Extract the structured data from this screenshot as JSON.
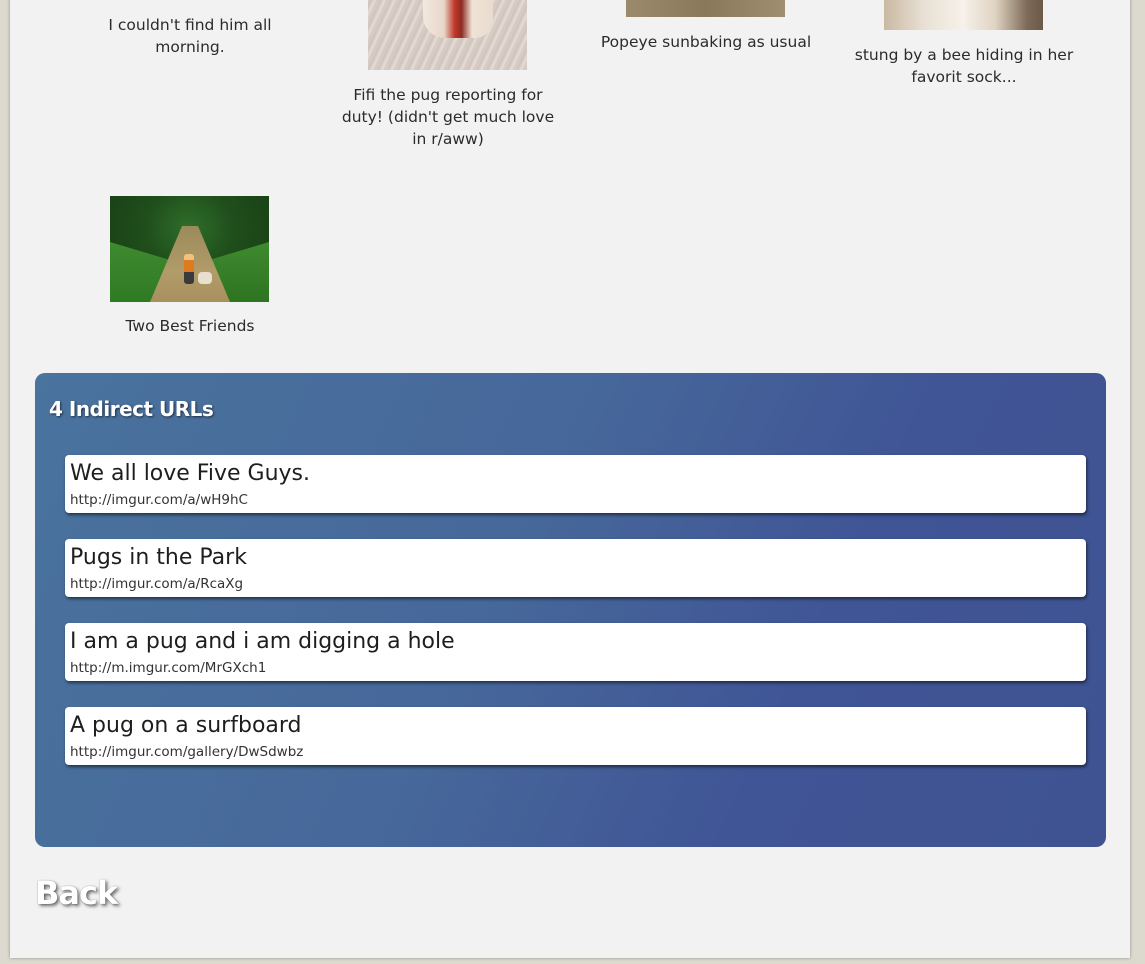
{
  "gallery": {
    "items": [
      {
        "caption": "I couldn't find him all morning."
      },
      {
        "caption": "Fifi the pug reporting for duty! (didn't get much love in r/aww)"
      },
      {
        "caption": "Popeye sunbaking as usual"
      },
      {
        "caption": "stung by a bee hiding in her favorit sock..."
      },
      {
        "caption": "Two Best Friends"
      }
    ]
  },
  "indirect": {
    "heading": "4 Indirect URLs",
    "links": [
      {
        "title": "We all love Five Guys.",
        "url": "http://imgur.com/a/wH9hC"
      },
      {
        "title": "Pugs in the Park",
        "url": "http://imgur.com/a/RcaXg"
      },
      {
        "title": "I am a pug and i am digging a hole",
        "url": "http://m.imgur.com/MrGXch1"
      },
      {
        "title": "A pug on a surfboard",
        "url": "http://imgur.com/gallery/DwSdwbz"
      }
    ]
  },
  "nav": {
    "back_label": "Back"
  },
  "colors": {
    "panel_start": "#4a739e",
    "panel_end": "#3f5392",
    "page_bg": "#f2f2f2"
  }
}
